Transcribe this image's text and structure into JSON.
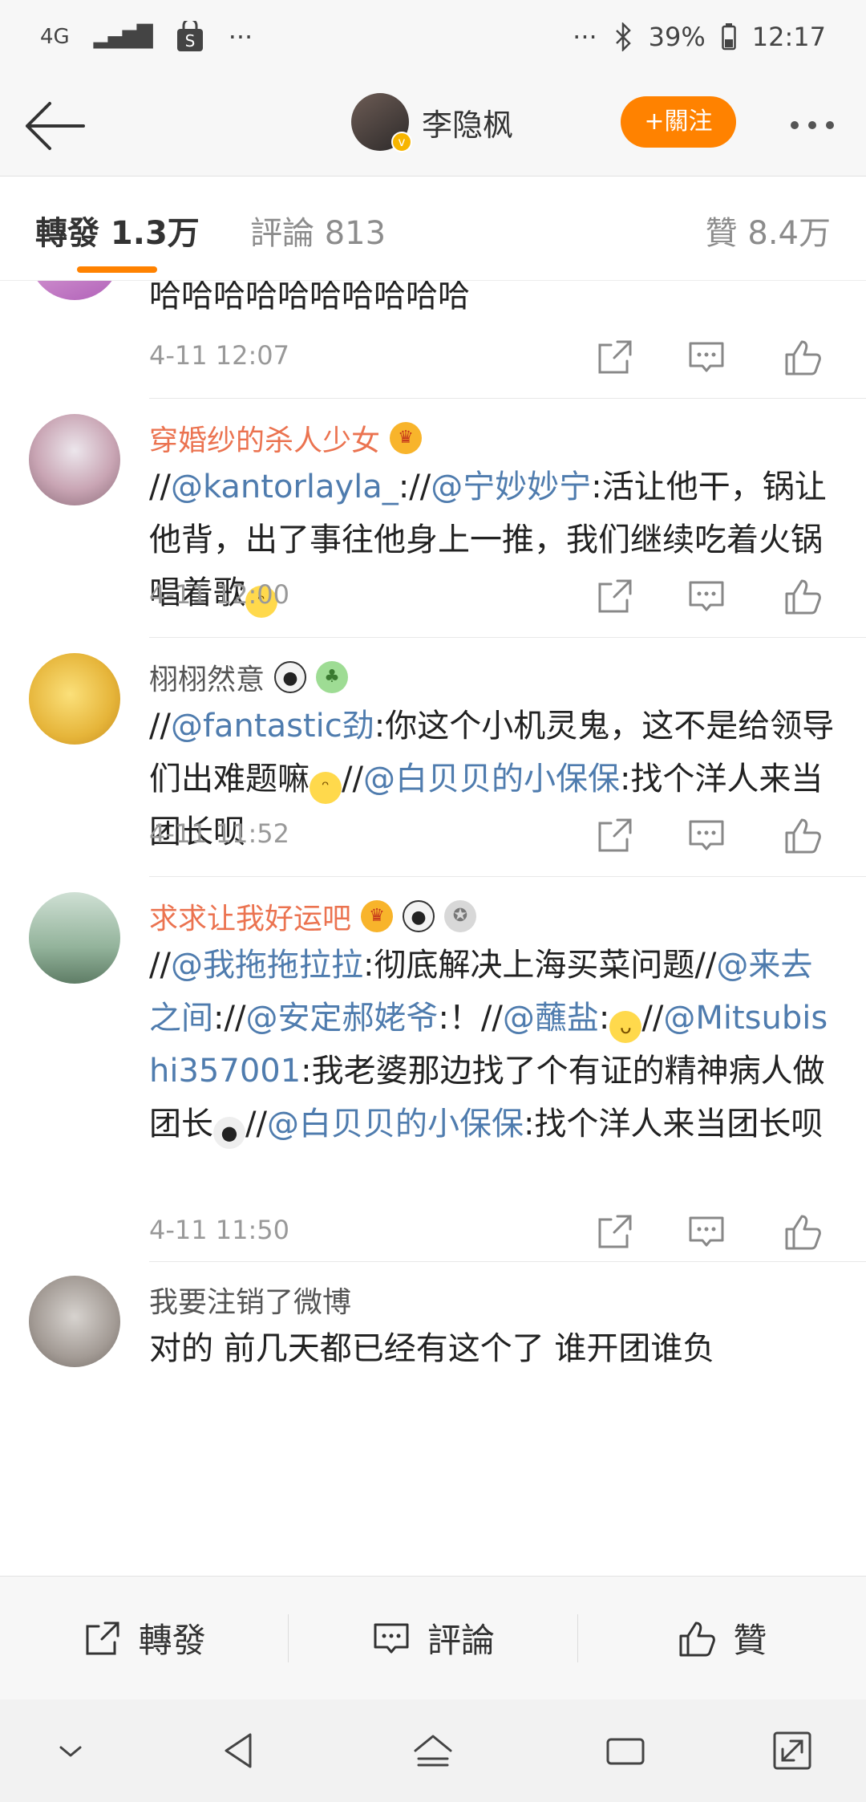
{
  "status_bar": {
    "network": "4G",
    "overflow": "···",
    "overflow_right": "···",
    "battery": "39%",
    "time": "12:17"
  },
  "header": {
    "profile_name": "李隐枫",
    "follow_label": "+關注"
  },
  "tabs": {
    "repost": "轉發 1.3万",
    "comment": "評論 813",
    "like": "贊 8.4万"
  },
  "posts": [
    {
      "text": "哈哈哈哈哈哈哈哈哈哈",
      "time": "4-11 12:07"
    },
    {
      "user": "穿婚纱的杀人少女",
      "line1_a": "//",
      "line1_m1": "@kantorlayla_",
      "line1_b": "://",
      "line1_m2": "@宁妙妙宁",
      "line1_c": ":活让他干，锅让他背，出了事往他身上一推，我们继续吃着火锅唱着歌",
      "time": "4-11 12:00"
    },
    {
      "user": "栩栩然意",
      "a": "//",
      "m1": "@fantastic劲",
      "b": ":你这个小机灵鬼，这不是给领导们出难题嘛",
      "c": "//",
      "m2": "@白贝贝的小保保",
      "d": ":找个洋人来当团长呗",
      "time": "4-11 11:52"
    },
    {
      "user": "求求让我好运吧",
      "a": "//",
      "m1": "@我拖拖拉拉",
      "b": ":彻底解决上海买菜问题//",
      "m2": "@来去之间",
      "c": "://",
      "m3": "@安定郝姥爷",
      "d": ":！//",
      "m4": "@蘸盐",
      "e": ":",
      "f": "//",
      "m5": "@Mitsubishi357001",
      "g": ":我老婆那边找了个有证的精神病人做团长",
      "h": "//",
      "m6": "@白贝贝的小保保",
      "i": ":找个洋人来当团长呗",
      "time": "4-11 11:50"
    },
    {
      "user": "我要注销了微博",
      "text": "对的 前几天都已经有这个了 谁开团谁负"
    }
  ],
  "bottom_bar": {
    "repost": "轉發",
    "comment": "評論",
    "like": "贊"
  },
  "colors": {
    "accent": "#ff8200",
    "mention": "#4f7cae",
    "vip_name": "#eb7350"
  }
}
